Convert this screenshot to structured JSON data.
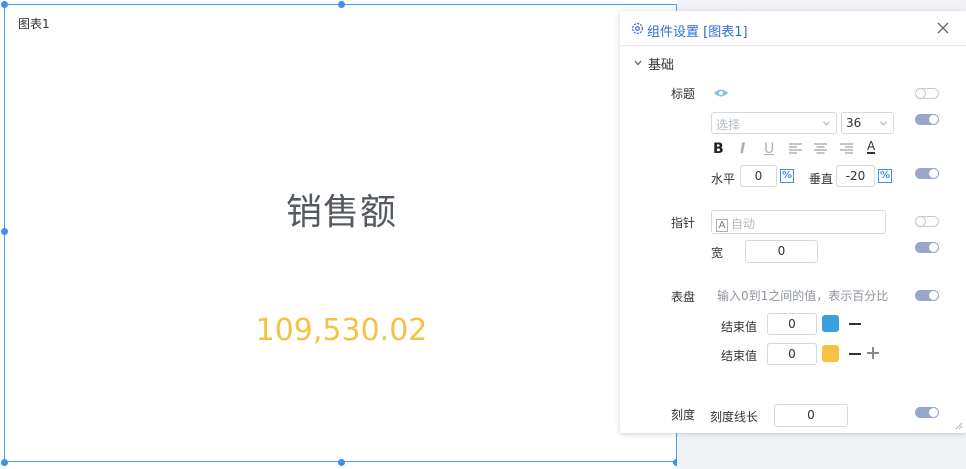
{
  "canvas": {
    "widget_label": "图表1",
    "gauge_title": "销售额",
    "gauge_value": "109,530.02"
  },
  "panel": {
    "title": "组件设置 [图表1]",
    "section": "基础",
    "title_row": {
      "label": "标题",
      "font_placeholder": "选择",
      "font_size": "36",
      "format": {
        "bold": "B",
        "italic": "I",
        "underline": "U",
        "color": "A"
      },
      "horizontal_label": "水平",
      "horizontal_value": "0",
      "vertical_label": "垂直",
      "vertical_value": "-20",
      "percent_symbol": "%"
    },
    "pointer_row": {
      "label": "指针",
      "placeholder": "自动",
      "icon_letter": "A",
      "width_label": "宽",
      "width_value": "0"
    },
    "dial_row": {
      "label": "表盘",
      "hint": "输入0到1之间的值，表示百分比",
      "ranges": [
        {
          "label": "结束值",
          "value": "0",
          "color": "#3aa0dd"
        },
        {
          "label": "结束值",
          "value": "0",
          "color": "#f5c342"
        }
      ]
    },
    "scale_row": {
      "label": "刻度",
      "length_label": "刻度线长",
      "length_value": "0"
    },
    "colors": {
      "accent": "#3f8ef0",
      "title_blue": "#2d6cd8",
      "toggle_on": "#98a8c8",
      "value_yellow": "#f5c342"
    },
    "toggles": {
      "title_visible": false,
      "font": true,
      "position": true,
      "pointer": false,
      "width": true,
      "dial": true,
      "scale": true
    }
  }
}
